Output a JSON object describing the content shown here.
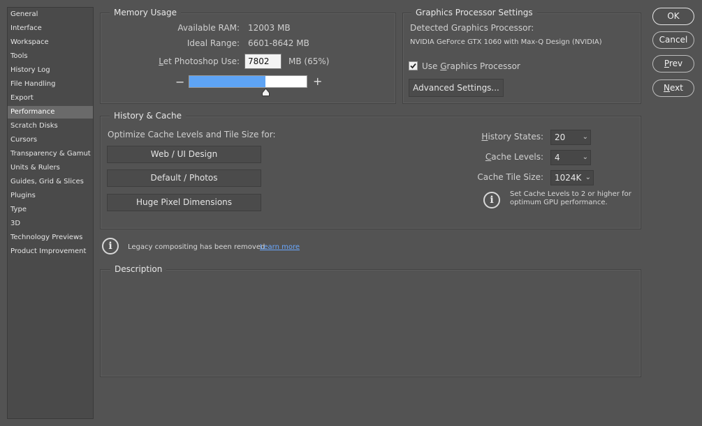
{
  "sidebar": {
    "items": [
      {
        "label": "General"
      },
      {
        "label": "Interface"
      },
      {
        "label": "Workspace"
      },
      {
        "label": "Tools"
      },
      {
        "label": "History Log"
      },
      {
        "label": "File Handling"
      },
      {
        "label": "Export"
      },
      {
        "label": "Performance",
        "active": true
      },
      {
        "label": "Scratch Disks"
      },
      {
        "label": "Cursors"
      },
      {
        "label": "Transparency & Gamut"
      },
      {
        "label": "Units & Rulers"
      },
      {
        "label": "Guides, Grid & Slices"
      },
      {
        "label": "Plugins"
      },
      {
        "label": "Type"
      },
      {
        "label": "3D"
      },
      {
        "label": "Technology Previews"
      },
      {
        "label": "Product Improvement"
      }
    ]
  },
  "memory": {
    "title": "Memory Usage",
    "available_label": "Available RAM:",
    "available_value": "12003 MB",
    "ideal_label": "Ideal Range:",
    "ideal_value": "6601-8642 MB",
    "use_label": "Let Photoshop Use:",
    "use_value": "7802",
    "use_unit": "MB (65%)",
    "slider_fraction": 0.65,
    "minus": "−",
    "plus": "+"
  },
  "gpu": {
    "title": "Graphics Processor Settings",
    "detected_label": "Detected Graphics Processor:",
    "detected_value": "NVIDIA GeForce GTX 1060 with Max-Q Design (NVIDIA)",
    "use_gpu_label": "Use Graphics Processor",
    "use_gpu_checked": true,
    "advanced_button": "Advanced Settings..."
  },
  "history_cache": {
    "title": "History & Cache",
    "optimize_label": "Optimize Cache Levels and Tile Size for:",
    "btn_web": "Web / UI Design",
    "btn_default": "Default / Photos",
    "btn_huge": "Huge Pixel Dimensions",
    "history_states_label": "History States:",
    "history_states_value": "20",
    "cache_levels_label": "Cache Levels:",
    "cache_levels_value": "4",
    "cache_tile_label": "Cache Tile Size:",
    "cache_tile_value": "1024K",
    "tip_line1": "Set Cache Levels to 2 or higher for",
    "tip_line2": "optimum GPU performance."
  },
  "legacy": {
    "text": "Legacy compositing has been removed",
    "link": "Learn more"
  },
  "description": {
    "title": "Description"
  },
  "actions": {
    "ok": "OK",
    "cancel": "Cancel",
    "prev": "Prev",
    "next": "Next"
  },
  "colors": {
    "background": "#535353",
    "slider_fill": "#5ea4f5",
    "active_item": "#6a6a6a"
  }
}
